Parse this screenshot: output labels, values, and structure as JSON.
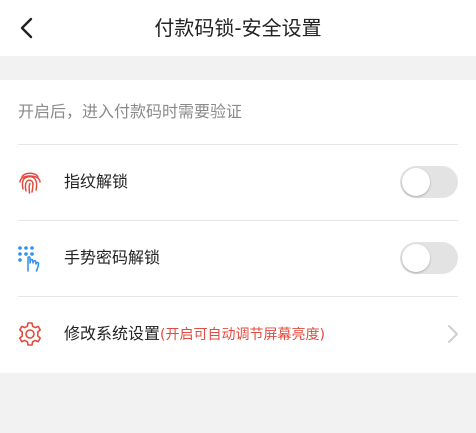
{
  "header": {
    "title": "付款码锁-安全设置",
    "back_icon": "chevron-left-icon"
  },
  "hint": "开启后，进入付款码时需要验证",
  "rows": [
    {
      "label": "指纹解锁",
      "icon": "fingerprint-icon",
      "toggle_on": false
    },
    {
      "label": "手势密码解锁",
      "icon": "gesture-pattern-icon",
      "toggle_on": false
    },
    {
      "label": "修改系统设置",
      "note": "(开启可自动调节屏幕亮度)",
      "icon": "gear-icon"
    }
  ],
  "colors": {
    "accent_red": "#e24b3f",
    "icon_blue": "#2f8ff0",
    "toggle_off": "#e3e3e3",
    "background": "#f2f2f2"
  }
}
